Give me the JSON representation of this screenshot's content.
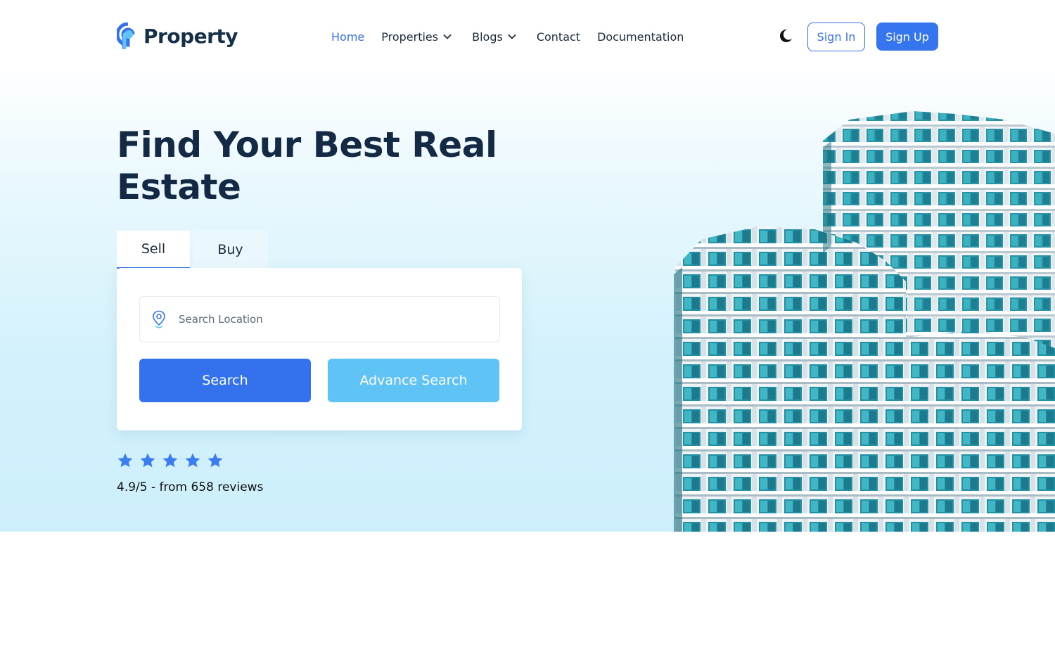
{
  "header": {
    "logo_text": "Property",
    "nav": [
      {
        "label": "Home",
        "active": true,
        "dropdown": false
      },
      {
        "label": "Properties",
        "active": false,
        "dropdown": true
      },
      {
        "label": "Blogs",
        "active": false,
        "dropdown": true
      },
      {
        "label": "Contact",
        "active": false,
        "dropdown": false
      },
      {
        "label": "Documentation",
        "active": false,
        "dropdown": false
      }
    ],
    "theme_icon": "moon-icon",
    "sign_in_label": "Sign In",
    "sign_up_label": "Sign Up"
  },
  "hero": {
    "headline": "Find Your Best Real Estate",
    "tabs": [
      {
        "label": "Sell",
        "selected": true
      },
      {
        "label": "Buy",
        "selected": false
      }
    ],
    "search": {
      "placeholder": "Search Location",
      "value": "",
      "icon": "location-pin-icon",
      "search_label": "Search",
      "advance_label": "Advance Search"
    },
    "rating": {
      "stars": 5,
      "text": "4.9/5 - from 658 reviews"
    }
  },
  "colors": {
    "accent": "#3672e8",
    "secondary_button": "#60c3f6",
    "heading": "#142a44",
    "hero_background": "#d2f1fc"
  }
}
